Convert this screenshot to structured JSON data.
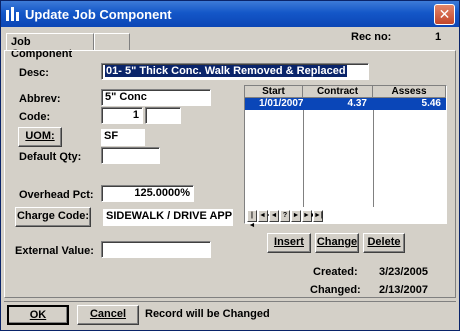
{
  "window": {
    "title": "Update Job Component"
  },
  "tabs": [
    {
      "label": "Job Component"
    },
    {
      "label": ""
    }
  ],
  "rec": {
    "label": "Rec no:",
    "value": "1"
  },
  "form": {
    "desc_label": "Desc:",
    "desc_value": "01- 5\" Thick Conc. Walk Removed & Replaced",
    "abbrev_label": "Abbrev:",
    "abbrev_value": "5\" Conc",
    "code_label": "Code:",
    "code_value_1": "1",
    "code_value_2": "",
    "uom_button": "UOM:",
    "uom_value": "SF",
    "default_qty_label": "Default Qty:",
    "default_qty_value": "",
    "overhead_label": "Overhead Pct:",
    "overhead_value": "125.0000%",
    "charge_code_button": "Charge Code:",
    "charge_code_value": "SIDEWALK / DRIVE APP",
    "external_value_label": "External Value:",
    "external_value_value": ""
  },
  "grid": {
    "columns": [
      "Start",
      "Contract",
      "Assess"
    ],
    "rows": [
      {
        "start": "1/01/2007",
        "contract": "4.37",
        "assess": "5.46"
      }
    ],
    "nav": [
      "|◄",
      "◄◄",
      "◄",
      "?",
      "►",
      "►►",
      "►|"
    ]
  },
  "actions": {
    "insert": "Insert",
    "change": "Change",
    "delete": "Delete"
  },
  "dates": {
    "created_label": "Created:",
    "created_value": "3/23/2005",
    "changed_label": "Changed:",
    "changed_value": "2/13/2007"
  },
  "status": {
    "ok": "OK",
    "cancel": "Cancel",
    "message": "Record will be Changed"
  },
  "colors": {
    "titlebar": "#0b45b5",
    "selection": "#0a246a",
    "face": "#d4d0c8"
  }
}
